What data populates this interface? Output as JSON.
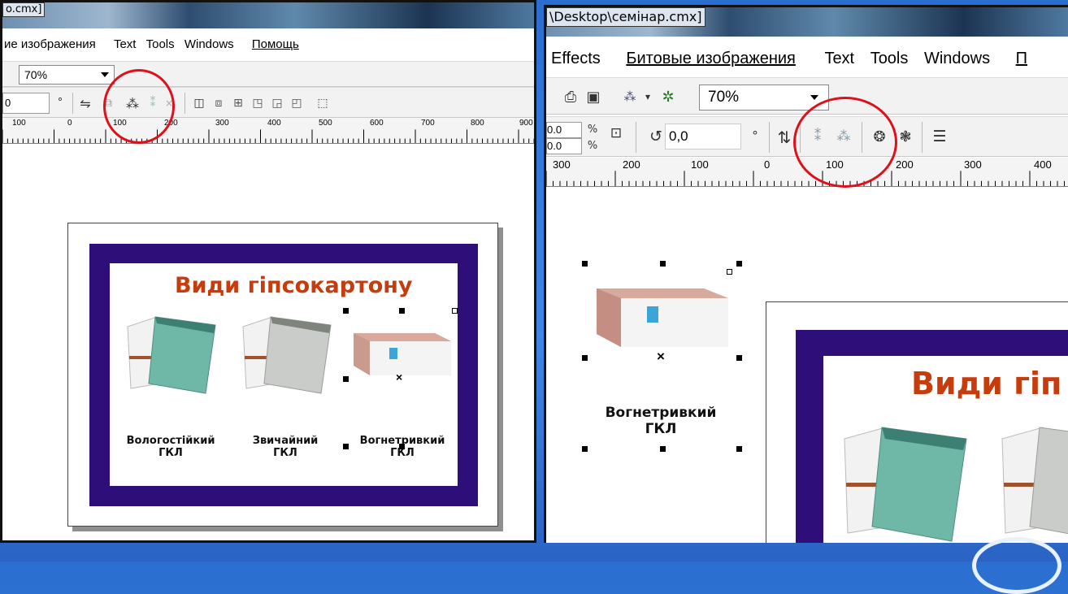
{
  "left": {
    "title": "o.cmx]",
    "menu": [
      "ие изображения",
      "Text",
      "Tools",
      "Windows",
      "Помощь"
    ],
    "zoom": "70%",
    "numbox": "0",
    "degree": "°",
    "ruler_labels": [
      "100",
      "0",
      "100",
      "200",
      "300",
      "400",
      "500",
      "600",
      "700",
      "800",
      "900"
    ],
    "slide": {
      "title": "Види гіпсокартону",
      "captions": [
        {
          "line1": "Вологостійкий",
          "line2": "ГКЛ"
        },
        {
          "line1": "Звичайний",
          "line2": "ГКЛ"
        },
        {
          "line1": "Вогнетривкий",
          "line2": "ГКЛ"
        }
      ]
    }
  },
  "right": {
    "title": "\\Desktop\\семінар.cmx]",
    "menu": [
      "Effects",
      "Битовые изображения",
      "Text",
      "Tools",
      "Windows",
      "П"
    ],
    "zoom": "70%",
    "num_a": "0.0",
    "num_b": "0.0",
    "pct": "%",
    "angle": "0,0",
    "degree": "°",
    "ruler_labels": [
      "300",
      "200",
      "100",
      "0",
      "100",
      "200",
      "300",
      "400"
    ],
    "caption": {
      "line1": "Вогнетривкий",
      "line2": "ГКЛ"
    },
    "slide_title": "Види гіп"
  },
  "colors": {
    "slide_frame": "#2e0e78",
    "title_text": "#c63c0c",
    "highlight_circle": "#e0101a",
    "background": "#2f74d8"
  }
}
